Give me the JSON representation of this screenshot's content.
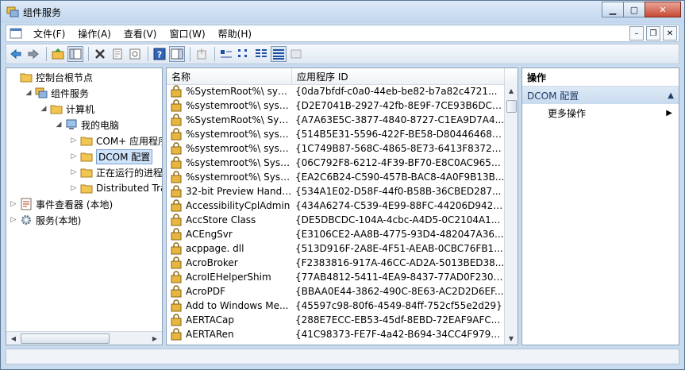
{
  "window": {
    "title": "组件服务"
  },
  "menu": {
    "items": [
      {
        "name": "menu-file",
        "label": "文件(F)"
      },
      {
        "name": "menu-action",
        "label": "操作(A)"
      },
      {
        "name": "menu-view",
        "label": "查看(V)"
      },
      {
        "name": "menu-window",
        "label": "窗口(W)"
      },
      {
        "name": "menu-help",
        "label": "帮助(H)"
      }
    ]
  },
  "tree": {
    "nodes": [
      {
        "name": "tree-root",
        "label": "控制台根节点",
        "level": 0,
        "expander": "",
        "icon": "folder-icon"
      },
      {
        "name": "tree-component-services",
        "label": "组件服务",
        "level": 1,
        "expander": "◢",
        "icon": "component-services-icon"
      },
      {
        "name": "tree-computers",
        "label": "计算机",
        "level": 2,
        "expander": "◢",
        "icon": "folder-icon"
      },
      {
        "name": "tree-my-computer",
        "label": "我的电脑",
        "level": 3,
        "expander": "◢",
        "icon": "computer-icon"
      },
      {
        "name": "tree-com-plus",
        "label": "COM+ 应用程序",
        "level": 4,
        "expander": "▷",
        "icon": "folder-icon"
      },
      {
        "name": "tree-dcom-config",
        "label": "DCOM 配置",
        "level": 4,
        "expander": "▷",
        "icon": "folder-icon",
        "selected": true
      },
      {
        "name": "tree-running-processes",
        "label": "正在运行的进程",
        "level": 4,
        "expander": "▷",
        "icon": "folder-icon"
      },
      {
        "name": "tree-distributed-trans",
        "label": "Distributed Trar",
        "level": 4,
        "expander": "▷",
        "icon": "folder-icon"
      },
      {
        "name": "tree-event-viewer",
        "label": "事件查看器 (本地)",
        "level": 0,
        "expander": "▷",
        "icon": "event-viewer-icon"
      },
      {
        "name": "tree-services",
        "label": "服务(本地)",
        "level": 0,
        "expander": "▷",
        "icon": "services-gear-icon"
      }
    ]
  },
  "grid": {
    "columns": [
      "名称",
      "应用程序 ID"
    ],
    "rows": [
      [
        "%SystemRoot%\\ syst...",
        "{0da7bfdf-c0a0-44eb-be82-b7a82c4721..."
      ],
      [
        "%systemroot%\\ syste...",
        "{D2E7041B-2927-42fb-8E9F-7CE93B6DC9..."
      ],
      [
        "%SystemRoot%\\ Syst...",
        "{A7A63E5C-3877-4840-8727-C1EA9D7A4..."
      ],
      [
        "%systemroot%\\ syste...",
        "{514B5E31-5596-422F-BE58-D804464683..."
      ],
      [
        "%systemroot%\\ syste...",
        "{1C749B87-568C-4865-8E73-6413F8372C..."
      ],
      [
        "%systemroot%\\ Syst...",
        "{06C792F8-6212-4F39-BF70-E8C0AC965C..."
      ],
      [
        "%systemroot%\\ Syst...",
        "{EA2C6B24-C590-457B-BAC8-4A0F9B13B..."
      ],
      [
        "32-bit Preview Handl...",
        "{534A1E02-D58F-44f0-B58B-36CBED287..."
      ],
      [
        "AccessibilityCplAdmin",
        "{434A6274-C539-4E99-88FC-44206D9427..."
      ],
      [
        "AccStore Class",
        "{DE5DBCDC-104A-4cbc-A4D5-0C2104A1..."
      ],
      [
        "ACEngSvr",
        "{E3106CE2-AA8B-4775-93D4-482047A36..."
      ],
      [
        "acppage. dll",
        "{513D916F-2A8E-4F51-AEAB-0CBC76FB1..."
      ],
      [
        "AcroBroker",
        "{F2383816-917A-46CC-AD2A-5013BED38..."
      ],
      [
        "AcroIEHelperShim",
        "{77AB4812-5411-4EA9-8437-77AD0F2303..."
      ],
      [
        "AcroPDF",
        "{BBAA0E44-3862-490C-8E63-AC2D2D6EF..."
      ],
      [
        "Add to Windows Me...",
        "{45597c98-80f6-4549-84ff-752cf55e2d29}"
      ],
      [
        "AERTACap",
        "{288E7ECC-EB53-45df-8EBD-72EAF9AFC..."
      ],
      [
        "AERTARen",
        "{41C98373-FE7F-4a42-B694-34CC4F979E..."
      ]
    ]
  },
  "actions": {
    "title": "操作",
    "section": "DCOM 配置",
    "items": [
      {
        "name": "more-actions",
        "label": "更多操作"
      }
    ]
  },
  "colors": {
    "accent": "#c9dcef",
    "selection": "#cfe3fb"
  }
}
